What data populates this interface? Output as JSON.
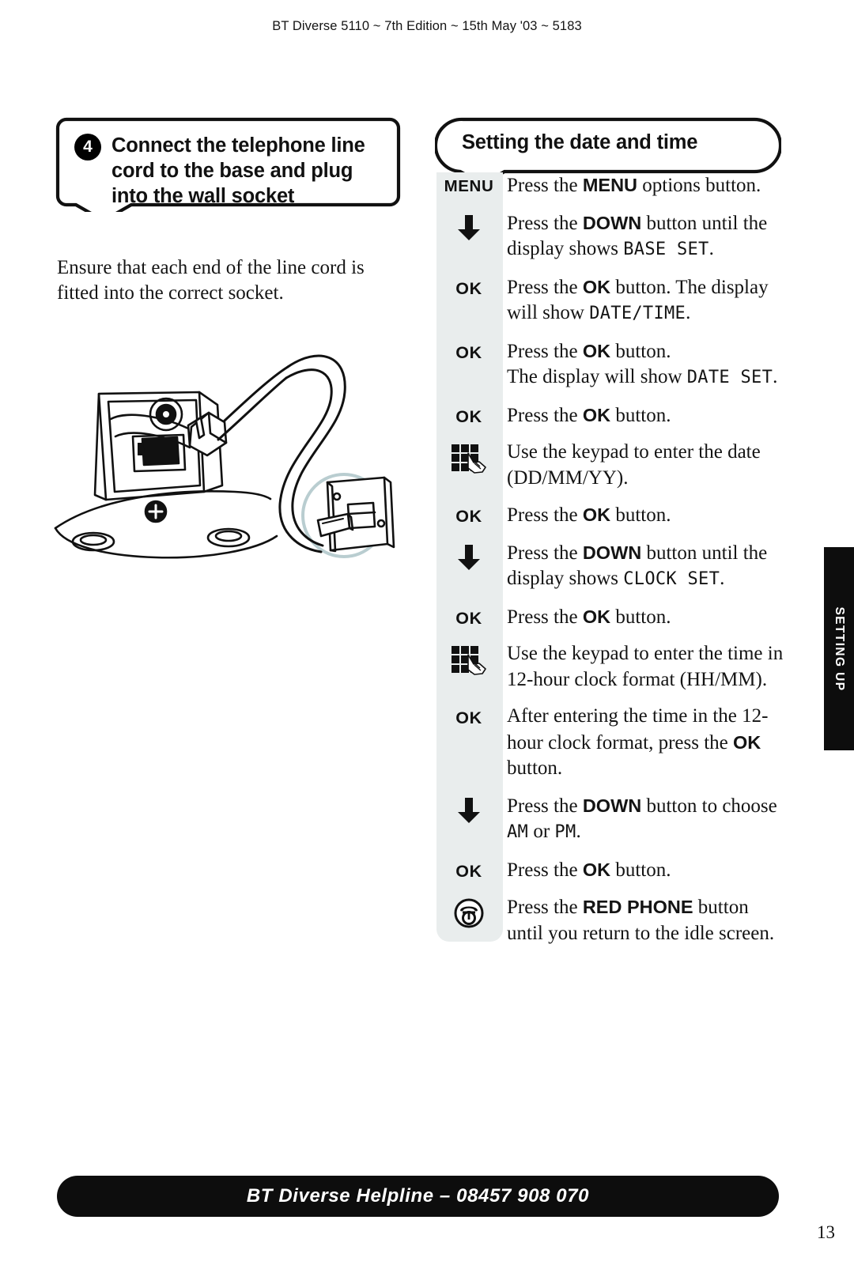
{
  "header": {
    "running_head": "BT Diverse 5110 ~ 7th Edition ~ 15th May '03 ~ 5183"
  },
  "left_column": {
    "step_callout": {
      "number": "4",
      "title": "Connect the telephone line cord to the base and plug into the wall socket"
    },
    "lead_paragraph": "Ensure that each end of the line cord is fitted into the correct socket.",
    "illustration": {
      "name": "base-unit-line-cord-wall-socket-diagram",
      "highlight_circle_color": "#b9cdd0"
    }
  },
  "right_column": {
    "section_title": "Setting the date and time",
    "steps": [
      {
        "icon": "menu-key-icon",
        "icon_label": "MENU",
        "text_parts": [
          {
            "t": "Press the ",
            "style": "normal"
          },
          {
            "t": "MENU",
            "style": "bold"
          },
          {
            "t": " options button.",
            "style": "normal"
          }
        ]
      },
      {
        "icon": "down-arrow-icon",
        "icon_label": "",
        "text_parts": [
          {
            "t": "Press the ",
            "style": "normal"
          },
          {
            "t": "DOWN",
            "style": "bold"
          },
          {
            "t": " button until the display shows ",
            "style": "normal"
          },
          {
            "t": "BASE SET",
            "style": "lcd"
          },
          {
            "t": ".",
            "style": "normal"
          }
        ]
      },
      {
        "icon": "ok-key-icon",
        "icon_label": "OK",
        "text_parts": [
          {
            "t": "Press the ",
            "style": "normal"
          },
          {
            "t": "OK",
            "style": "bold"
          },
          {
            "t": " button. The display will show ",
            "style": "normal"
          },
          {
            "t": "DATE/TIME",
            "style": "lcd"
          },
          {
            "t": ".",
            "style": "normal"
          }
        ]
      },
      {
        "icon": "ok-key-icon",
        "icon_label": "OK",
        "text_parts": [
          {
            "t": "Press the ",
            "style": "normal"
          },
          {
            "t": "OK",
            "style": "bold"
          },
          {
            "t": " button.",
            "style": "normal"
          },
          {
            "t": "BREAK",
            "style": "break"
          },
          {
            "t": "The display will show ",
            "style": "normal"
          },
          {
            "t": "DATE SET",
            "style": "lcd"
          },
          {
            "t": ".",
            "style": "normal"
          }
        ]
      },
      {
        "icon": "ok-key-icon",
        "icon_label": "OK",
        "text_parts": [
          {
            "t": "Press the ",
            "style": "normal"
          },
          {
            "t": "OK",
            "style": "bold"
          },
          {
            "t": " button.",
            "style": "normal"
          }
        ]
      },
      {
        "icon": "keypad-icon",
        "icon_label": "",
        "text_parts": [
          {
            "t": "Use the keypad to enter the date (DD/MM/YY).",
            "style": "normal"
          }
        ]
      },
      {
        "icon": "ok-key-icon",
        "icon_label": "OK",
        "text_parts": [
          {
            "t": "Press the ",
            "style": "normal"
          },
          {
            "t": "OK",
            "style": "bold"
          },
          {
            "t": " button.",
            "style": "normal"
          }
        ]
      },
      {
        "icon": "down-arrow-icon",
        "icon_label": "",
        "text_parts": [
          {
            "t": "Press the ",
            "style": "normal"
          },
          {
            "t": "DOWN",
            "style": "bold"
          },
          {
            "t": " button until the display shows ",
            "style": "normal"
          },
          {
            "t": "CLOCK SET",
            "style": "lcd"
          },
          {
            "t": ".",
            "style": "normal"
          }
        ]
      },
      {
        "icon": "ok-key-icon",
        "icon_label": "OK",
        "text_parts": [
          {
            "t": "Press the ",
            "style": "normal"
          },
          {
            "t": "OK",
            "style": "bold"
          },
          {
            "t": " button.",
            "style": "normal"
          }
        ]
      },
      {
        "icon": "keypad-icon",
        "icon_label": "",
        "text_parts": [
          {
            "t": "Use the keypad to enter the time in 12-hour clock format (HH/MM).",
            "style": "normal"
          }
        ]
      },
      {
        "icon": "ok-key-icon",
        "icon_label": "OK",
        "text_parts": [
          {
            "t": "After entering the time in the 12-hour clock format, press the ",
            "style": "normal"
          },
          {
            "t": "OK",
            "style": "bold"
          },
          {
            "t": " button.",
            "style": "normal"
          }
        ]
      },
      {
        "icon": "down-arrow-icon",
        "icon_label": "",
        "text_parts": [
          {
            "t": "Press the ",
            "style": "normal"
          },
          {
            "t": "DOWN",
            "style": "bold"
          },
          {
            "t": " button to choose ",
            "style": "normal"
          },
          {
            "t": "AM",
            "style": "lcd"
          },
          {
            "t": " or ",
            "style": "normal"
          },
          {
            "t": "PM",
            "style": "lcd"
          },
          {
            "t": ".",
            "style": "normal"
          }
        ]
      },
      {
        "icon": "ok-key-icon",
        "icon_label": "OK",
        "text_parts": [
          {
            "t": "Press the ",
            "style": "normal"
          },
          {
            "t": "OK",
            "style": "bold"
          },
          {
            "t": " button.",
            "style": "normal"
          }
        ]
      },
      {
        "icon": "red-phone-icon",
        "icon_label": "",
        "text_parts": [
          {
            "t": "Press the ",
            "style": "normal"
          },
          {
            "t": "RED PHONE",
            "style": "bold"
          },
          {
            "t": " button until you return to the idle screen.",
            "style": "normal"
          }
        ]
      }
    ]
  },
  "side_tab": {
    "label": "SETTING UP",
    "background": "#0d0d0d"
  },
  "footer": {
    "helpline": "BT Diverse Helpline – 08457 908 070",
    "page_number": "13",
    "background": "#0d0d0d"
  }
}
